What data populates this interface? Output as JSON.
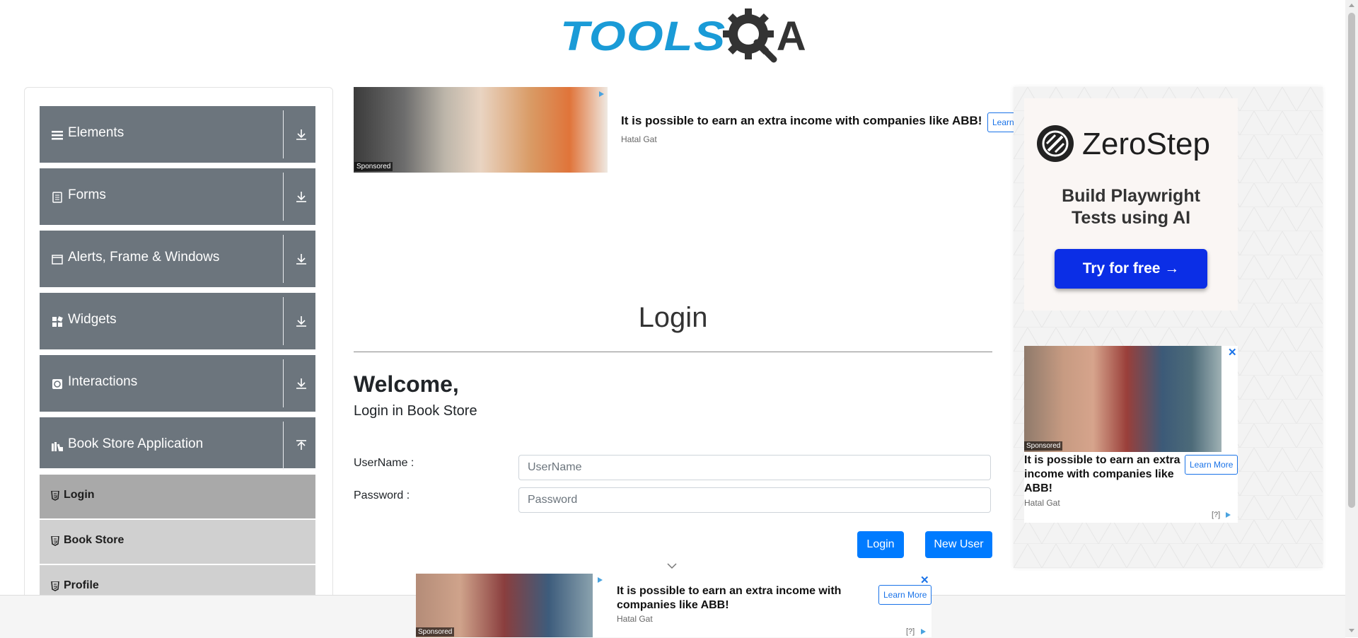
{
  "header": {
    "logo_tools": "TOOLS",
    "logo_qa_letter": "A"
  },
  "sidebar": {
    "groups": [
      {
        "label": "Elements",
        "icon": "hamburger-icon",
        "arrow": "down"
      },
      {
        "label": "Forms",
        "icon": "document-icon",
        "arrow": "down"
      },
      {
        "label": "Alerts, Frame & Windows",
        "icon": "window-icon",
        "arrow": "down"
      },
      {
        "label": "Widgets",
        "icon": "widgets-icon",
        "arrow": "down"
      },
      {
        "label": "Interactions",
        "icon": "interactions-icon",
        "arrow": "down"
      },
      {
        "label": "Book Store Application",
        "icon": "books-icon",
        "arrow": "up"
      }
    ],
    "book_store_items": [
      {
        "label": "Login",
        "active": true
      },
      {
        "label": "Book Store",
        "active": false
      },
      {
        "label": "Profile",
        "active": false
      }
    ]
  },
  "ads": {
    "top": {
      "sponsored": "Sponsored",
      "title": "It is possible to earn an extra income with companies like ABB!",
      "source": "Hatal Gat",
      "learn_more": "Learn"
    },
    "right_zerostep": {
      "brand": "ZeroStep",
      "tagline_line1": "Build Playwright",
      "tagline_line2": "Tests using AI",
      "cta": "Try for free →"
    },
    "right_second": {
      "sponsored": "Sponsored",
      "title": "It is possible to earn an extra income with companies like ABB!",
      "source": "Hatal Gat",
      "learn_more": "Learn More",
      "info": "[?]",
      "close": "✕"
    },
    "bottom": {
      "sponsored": "Sponsored",
      "title": "It is possible to earn an extra income with companies like ABB!",
      "source": "Hatal Gat",
      "learn_more": "Learn More",
      "info": "[?]",
      "close": "✕"
    }
  },
  "main": {
    "page_title": "Login",
    "welcome": "Welcome,",
    "subheading": "Login in Book Store",
    "username_label": "UserName :",
    "username_placeholder": "UserName",
    "username_value": "",
    "password_label": "Password :",
    "password_placeholder": "Password",
    "password_value": "",
    "login_button": "Login",
    "new_user_button": "New User"
  },
  "colors": {
    "sidebar_group_bg": "#6c757d",
    "sidebar_active_item": "#a9a9a9",
    "sidebar_item": "#d0d0d0",
    "primary_button": "#007bff",
    "logo_blue": "#1a9bd7",
    "zerostep_cta": "#0b2ee6"
  }
}
